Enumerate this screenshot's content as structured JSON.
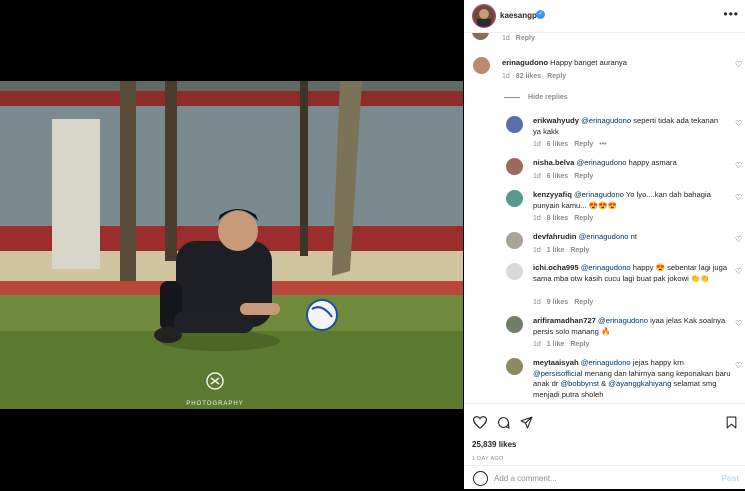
{
  "header": {
    "username": "kaesangp",
    "verified_mark": "✓",
    "more_icon": "•••"
  },
  "top_partial": {
    "time": "1d",
    "reply": "Reply"
  },
  "comments": [
    {
      "user": "erinagudono",
      "text": "Happy banget auranya",
      "time": "1d",
      "likes": "82 likes",
      "reply": "Reply"
    },
    {
      "user": "erikwahyudy",
      "mention": "@erinagudono",
      "text": " seperti tidak ada tekanan ya kakk",
      "time": "1d",
      "likes": "6 likes",
      "reply": "Reply",
      "dots": "•••"
    },
    {
      "user": "nisha.belva",
      "mention": "@erinagudono",
      "text": " happy asmara",
      "time": "1d",
      "likes": "6 likes",
      "reply": "Reply"
    },
    {
      "user": "kenzyyafiq",
      "mention": "@erinagudono",
      "text": " Yo lyo....kan dah bahagia punyain kamu... 😍😍😍",
      "time": "1d",
      "likes": "8 likes",
      "reply": "Reply"
    },
    {
      "user": "devfahrudin",
      "mention": "@erinagudono",
      "text": " nt",
      "time": "1d",
      "likes": "1 like",
      "reply": "Reply"
    },
    {
      "user": "ichi.ocha995",
      "mention": "@erinagudono",
      "text": " happy 😍 sebentar lagi juga sama mba otw kasih cucu lagi buat pak jokowi 👏👏",
      "time": "1d",
      "likes": "9 likes",
      "reply": "Reply"
    },
    {
      "user": "arifiramadhan727",
      "mention": "@erinagudono",
      "text": " iyaa jelas Kak soalnya persis solo manang 🔥",
      "time": "1d",
      "likes": "1 like",
      "reply": "Reply"
    },
    {
      "user": "meytaaisyah",
      "mention": "@erinagudono",
      "text": " jejas happy krn ",
      "mention2": "@persisofficial",
      "text2": " menang dan lahirnya sang keponakan baru anak dr ",
      "mention3": "@bobbynst",
      "text3": " & ",
      "mention4": "@ayanggkahiyang",
      "text4": " selamat smg menjadi putra sholeh"
    }
  ],
  "hide_replies": "Hide replies",
  "likes_count": "25,839 likes",
  "date": "1 DAY AGO",
  "add_comment_placeholder": "Add a comment...",
  "post_label": "Post",
  "icons": {
    "like": "heart-icon",
    "comment": "comment-icon",
    "share": "send-icon",
    "save": "bookmark-icon"
  },
  "colors": {
    "link": "#00376b",
    "muted": "#8e8e8e",
    "verified": "#3897f0",
    "post": "#b2dffc"
  }
}
